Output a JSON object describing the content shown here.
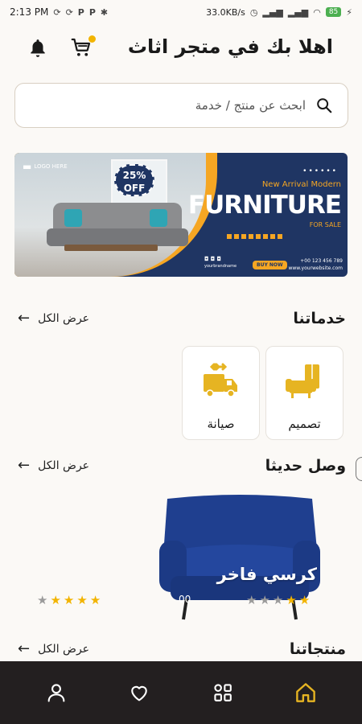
{
  "status_bar": {
    "time": "2:13 PM",
    "left_icons": [
      "sync-icon",
      "sync-icon",
      "p-icon",
      "p-icon",
      "puzzle-icon"
    ],
    "network_speed": "33.0KB/s",
    "battery": "85",
    "right_icons": [
      "alarm-icon",
      "signal-icon",
      "signal-icon",
      "wifi-icon",
      "battery-icon",
      "bolt-icon"
    ]
  },
  "header": {
    "title": "اهلا بك في متجر اثاث",
    "cart_icon": "cart-icon",
    "bell_icon": "bell-icon"
  },
  "search": {
    "placeholder": "ابحث عن منتج / خدمة",
    "icon": "search-icon"
  },
  "banner": {
    "logo_text": "LOGO HERE",
    "discount": "25%",
    "discount_suffix": "OFF",
    "tagline": "New Arrival Modern",
    "headline": "FURNITURE",
    "sub": "FOR SALE",
    "button": "BUY NOW",
    "phone": "+00 123 456 789",
    "site": "www.yourwebsite.com",
    "social_handle": "yourbrandname"
  },
  "services_section": {
    "title": "خدماتنا",
    "view_all": "عرض الكل",
    "items": [
      {
        "label": "تصميم",
        "icon": "armchair-design-icon"
      },
      {
        "label": "صيانة",
        "icon": "truck-wrench-icon"
      }
    ]
  },
  "new_arrivals_section": {
    "title": "وصل حديثا",
    "view_all": "عرض الكل",
    "products": [
      {
        "name": "كرسي فاخر",
        "rating": 2,
        "max_rating": 5,
        "price_fragment": "00"
      },
      {
        "name": "",
        "rating": 4,
        "max_rating": 5
      }
    ]
  },
  "products_section": {
    "title": "منتجاتنا",
    "view_all": "عرض الكل"
  },
  "bottom_nav": {
    "items": [
      "home-icon",
      "grid-icon",
      "heart-icon",
      "user-icon"
    ],
    "active": "home-icon",
    "accent": "#e6b422"
  },
  "colors": {
    "accent": "#e6b422",
    "nav_bg": "#231f20",
    "banner_navy": "#1f3563",
    "banner_orange": "#f5a623"
  }
}
